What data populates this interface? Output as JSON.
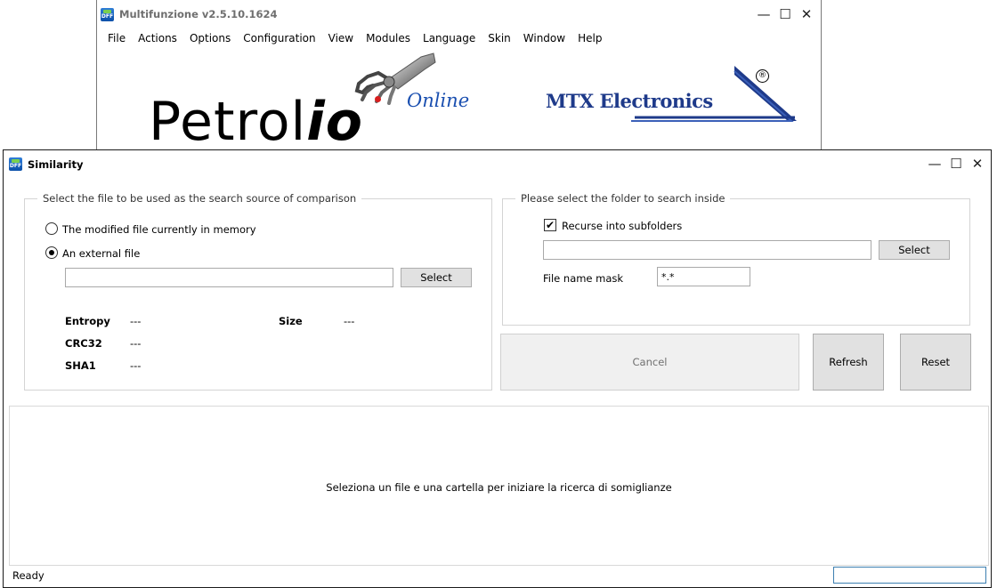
{
  "main_window": {
    "title": "Multifunzione v2.5.10.1624",
    "icon": "app-icon",
    "menu": [
      "File",
      "Actions",
      "Options",
      "Configuration",
      "View",
      "Modules",
      "Language",
      "Skin",
      "Window",
      "Help"
    ],
    "logo_left": {
      "text_main": "Petrol",
      "text_io": "io",
      "text_sub": "Online"
    },
    "logo_right": {
      "text": "MTX Electronics",
      "reg": "®"
    }
  },
  "similarity_window": {
    "title": "Similarity",
    "icon": "app-icon",
    "source_group": {
      "legend": "Select the file to be used as the search source of comparison",
      "option_memory": "The modified file currently in memory",
      "option_external": "An external file",
      "selected_option": "external",
      "file_path_value": "",
      "select_button": "Select",
      "entropy_label": "Entropy",
      "entropy_value": "---",
      "size_label": "Size",
      "size_value": "---",
      "crc32_label": "CRC32",
      "crc32_value": "---",
      "sha1_label": "SHA1",
      "sha1_value": "---"
    },
    "folder_group": {
      "legend": "Please select the folder to search inside",
      "recurse_label": "Recurse into subfolders",
      "recurse_checked": true,
      "folder_path_value": "",
      "select_button": "Select",
      "mask_label": "File name mask",
      "mask_value": "*.*"
    },
    "buttons": {
      "cancel": "Cancel",
      "refresh": "Refresh",
      "reset": "Reset"
    },
    "result_message": "Seleziona un file e una cartella per iniziare la ricerca di somiglianze",
    "status": {
      "text": "Ready",
      "progress": 0
    }
  },
  "colors": {
    "accent": "#3c7fb1",
    "logo_blue": "#1e3a8a",
    "logo_red": "#d81e1e"
  }
}
